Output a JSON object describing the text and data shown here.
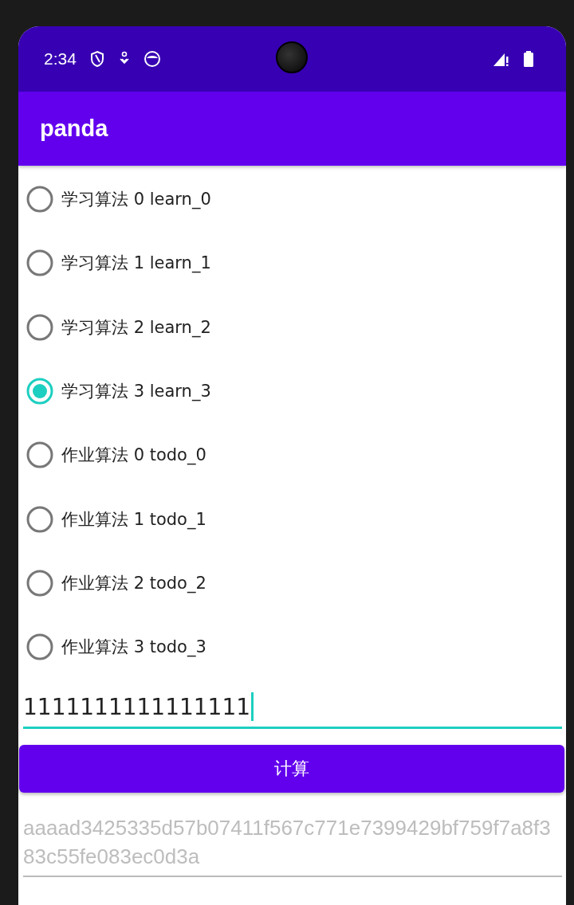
{
  "status_bar": {
    "time": "2:34"
  },
  "app_bar": {
    "title": "panda"
  },
  "options": [
    {
      "label": "学习算法 0 learn_0",
      "selected": false
    },
    {
      "label": "学习算法 1 learn_1",
      "selected": false
    },
    {
      "label": "学习算法 2 learn_2",
      "selected": false
    },
    {
      "label": "学习算法 3 learn_3",
      "selected": true
    },
    {
      "label": "作业算法 0 todo_0",
      "selected": false
    },
    {
      "label": "作业算法 1 todo_1",
      "selected": false
    },
    {
      "label": "作业算法 2 todo_2",
      "selected": false
    },
    {
      "label": "作业算法 3 todo_3",
      "selected": false
    }
  ],
  "input": {
    "value": "1111111111111111"
  },
  "button": {
    "label": "计算"
  },
  "result": {
    "value": "aaaad3425335d57b07411f567c771e7399429bf759f7a8f383c55fe083ec0d3a",
    "disabled": true
  }
}
